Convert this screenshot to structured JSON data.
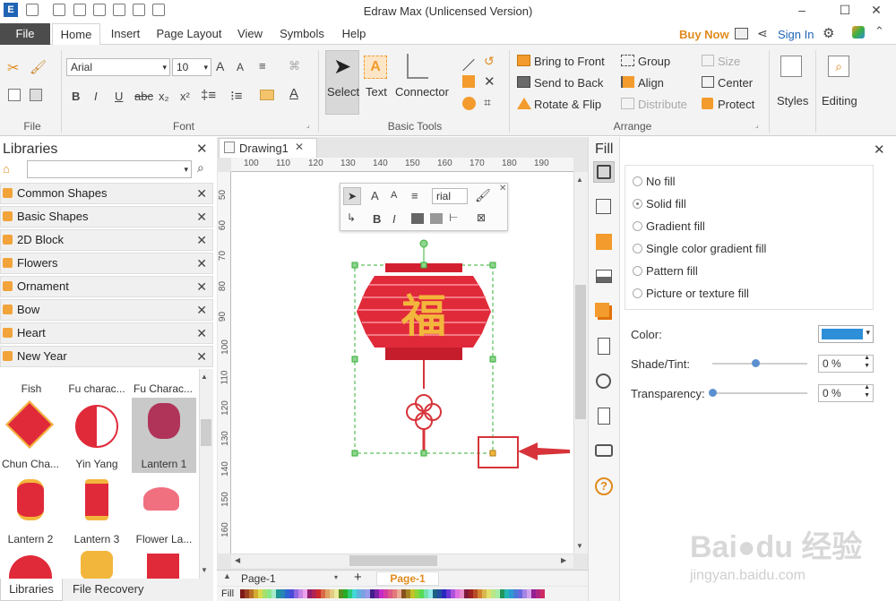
{
  "app": {
    "title": "Edraw Max (Unlicensed Version)"
  },
  "menu": {
    "file": "File",
    "tabs": [
      "Home",
      "Insert",
      "Page Layout",
      "View",
      "Symbols",
      "Help"
    ],
    "buy_now": "Buy Now",
    "sign_in": "Sign In"
  },
  "ribbon": {
    "font_name": "Arial",
    "font_size": "10",
    "group_file": "File",
    "group_font": "Font",
    "group_basic_tools": "Basic Tools",
    "group_arrange": "Arrange",
    "select": "Select",
    "text": "Text",
    "connector": "Connector",
    "bring_to_front": "Bring to Front",
    "send_to_back": "Send to Back",
    "rotate_flip": "Rotate & Flip",
    "group": "Group",
    "align": "Align",
    "distribute": "Distribute",
    "size": "Size",
    "center": "Center",
    "protect": "Protect",
    "styles": "Styles",
    "editing": "Editing"
  },
  "libraries": {
    "title": "Libraries",
    "items": [
      "Common Shapes",
      "Basic Shapes",
      "2D Block",
      "Flowers",
      "Ornament",
      "Bow",
      "Heart",
      "New Year"
    ],
    "shapes_top": [
      "Fish",
      "Fu charac...",
      "Fu Charac..."
    ],
    "shapes_row1": [
      "Chun Cha...",
      "Yin Yang",
      "Lantern 1"
    ],
    "shapes_row2": [
      "Lantern 2",
      "Lantern 3",
      "Flower La..."
    ],
    "tab_libraries": "Libraries",
    "tab_file_recovery": "File Recovery"
  },
  "canvas": {
    "tab": "Drawing1",
    "ruler_top": [
      "100",
      "110",
      "120",
      "130",
      "140",
      "150",
      "160",
      "170",
      "180",
      "190"
    ],
    "ruler_left": [
      "50",
      "60",
      "70",
      "80",
      "90",
      "100",
      "110",
      "120",
      "130",
      "140",
      "150",
      "160"
    ],
    "float_font": "rial",
    "lantern_char": "福",
    "page_tab": "Page-1",
    "page_active": "Page-1"
  },
  "fill": {
    "title": "Fill",
    "options": [
      "No fill",
      "Solid fill",
      "Gradient fill",
      "Single color gradient fill",
      "Pattern fill",
      "Picture or texture fill"
    ],
    "selected": "Solid fill",
    "color_label": "Color:",
    "shade_label": "Shade/Tint:",
    "shade_value": "0 %",
    "shade_level": 0.45,
    "transparency_label": "Transparency:",
    "transparency_value": "0 %",
    "transparency_level": 0,
    "color": "#2e8fd8"
  },
  "status": {
    "fill_label": "Fill"
  },
  "watermark": "jingyan.baidu.com",
  "colors": {
    "accent": "#f39b2c",
    "lantern_red": "#e02a3a",
    "lantern_gold": "#f3b63c",
    "selection": "#35b135",
    "callout": "#d6343a"
  }
}
